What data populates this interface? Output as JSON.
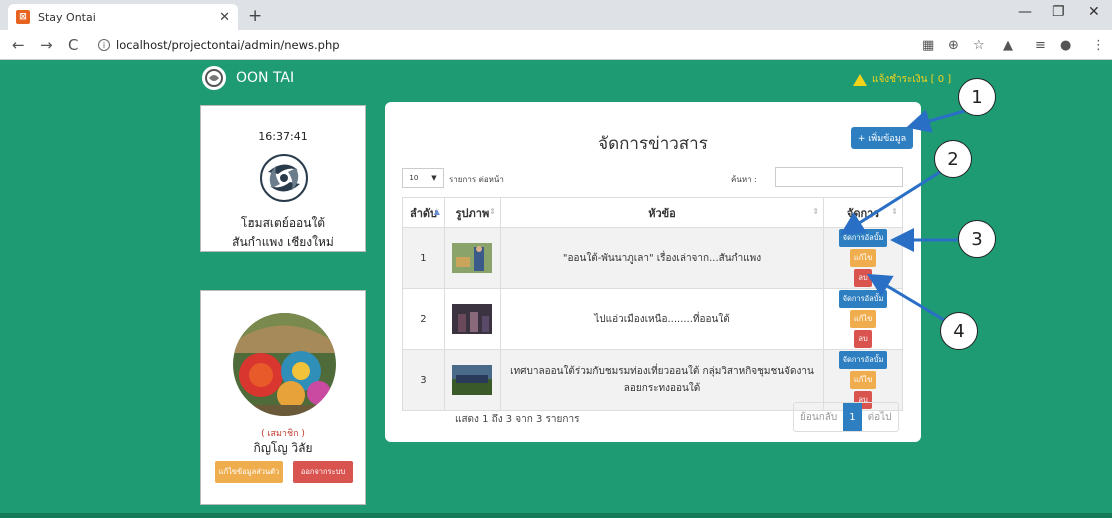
{
  "browser": {
    "tab_title": "Stay Ontai",
    "url": "localhost/projectontai/admin/news.php"
  },
  "header": {
    "brand": "OON TAI",
    "payment_alert": "แจ้งชำระเงิน [ 0 ]"
  },
  "clock_card": {
    "time": "16:37:41",
    "name_line1": "โฮมสเตย์ออนใต้",
    "name_line2": "สันกำแพง เชียงใหม่"
  },
  "profile": {
    "role": "( เสมาชิก )",
    "name": "กิญโญ วิลัย",
    "edit_button": "แก้ไขข้อมูลส่วนตัว",
    "logout_button": "ออกจากระบบ"
  },
  "main": {
    "title": "จัดการข่าวสาร",
    "add_button": "+ เพิ่มข้อมูล",
    "page_length_value": "10",
    "page_length_text": "รายการ ต่อหน้า",
    "search_label": "ค้นหา :",
    "columns": [
      "ลำดับ",
      "รูปภาพ",
      "หัวข้อ",
      "จัดการ"
    ],
    "rows": [
      {
        "no": "1",
        "title": "\"ออนใต้-พันนาภูเลา\" เรื่องเล่าจาก...สันกำแพง"
      },
      {
        "no": "2",
        "title": "ไปแอ่วเมืองเหนือ........ที่ออนใต้"
      },
      {
        "no": "3",
        "title": "เทศบาลออนใต้ร่วมกับชมรมท่องเที่ยวออนใต้ กลุ่มวิสาหกิจชุมชนจัดงานลอยกระทงออนใต้"
      }
    ],
    "actions": {
      "album": "จัดการอัลบั้ม",
      "edit": "แก้ไข",
      "delete": "ลบ"
    },
    "info": "แสดง 1 ถึง 3 จาก 3 รายการ",
    "pager": {
      "prev": "ย้อนกลับ",
      "current": "1",
      "next": "ต่อไป"
    }
  },
  "callouts": [
    "1",
    "2",
    "3",
    "4"
  ],
  "colors": {
    "page_bg": "#1f9b74",
    "primary": "#2e7fc1",
    "warning": "#f0ad4e",
    "danger": "#d9534f"
  }
}
